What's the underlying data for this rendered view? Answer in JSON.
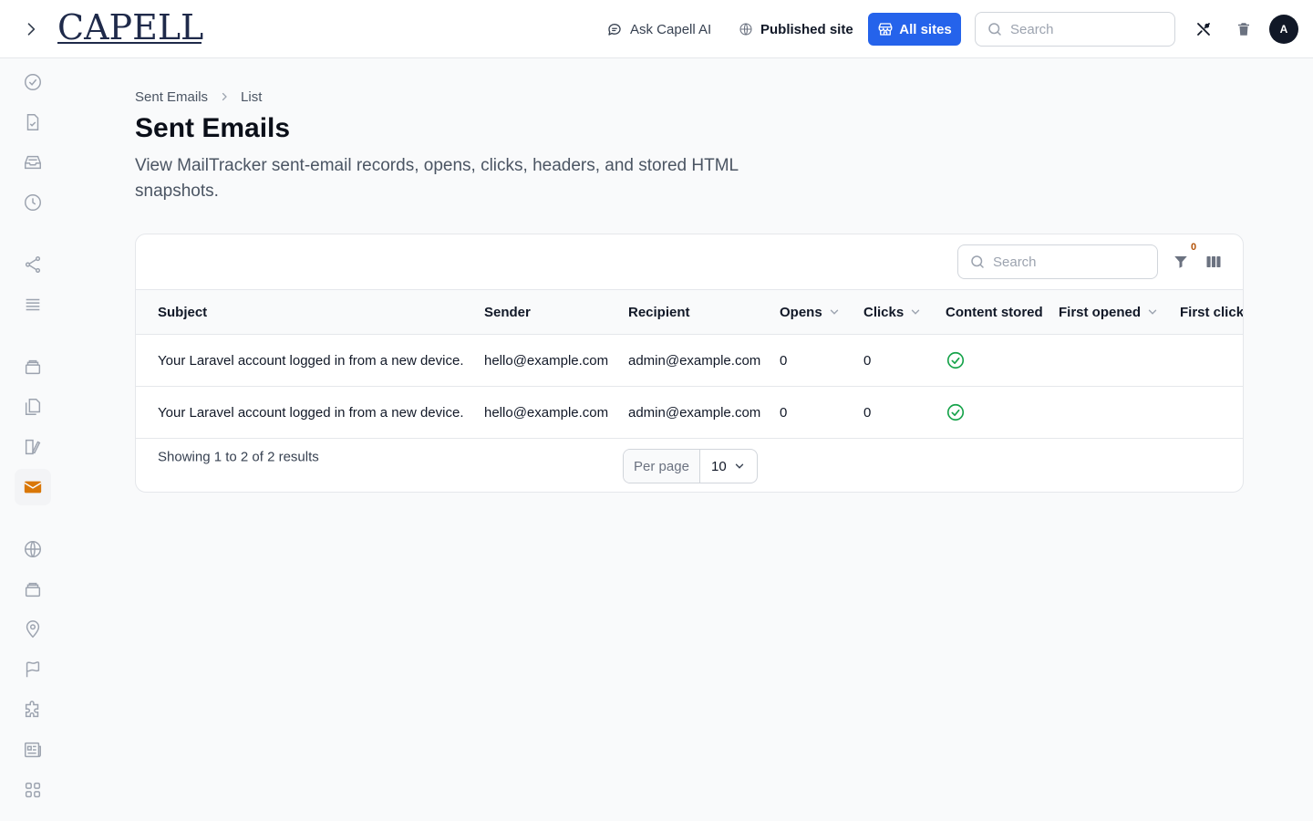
{
  "header": {
    "logo_text": "CAPELL",
    "ask_ai_label": "Ask Capell AI",
    "published_site_label": "Published site",
    "all_sites_label": "All sites",
    "search_placeholder": "Search",
    "avatar_initial": "A"
  },
  "sidebar": {
    "items": [
      {
        "name": "sidebar-item-tasks",
        "icon": "check-circle-icon"
      },
      {
        "name": "sidebar-item-documents",
        "icon": "document-check-icon"
      },
      {
        "name": "sidebar-item-inbox",
        "icon": "inbox-icon"
      },
      {
        "name": "sidebar-item-history",
        "icon": "clock-icon"
      },
      {
        "name": "sidebar-item-share",
        "icon": "share-icon"
      },
      {
        "name": "sidebar-item-list",
        "icon": "list-icon"
      },
      {
        "name": "sidebar-item-stack",
        "icon": "stack-icon"
      },
      {
        "name": "sidebar-item-pages",
        "icon": "copy-icon"
      },
      {
        "name": "sidebar-item-editor",
        "icon": "edit-icon"
      },
      {
        "name": "sidebar-item-emails",
        "icon": "envelope-icon",
        "active": true
      },
      {
        "name": "sidebar-item-globe",
        "icon": "globe-icon"
      },
      {
        "name": "sidebar-item-archive",
        "icon": "stack-icon"
      },
      {
        "name": "sidebar-item-locations",
        "icon": "map-pin-icon"
      },
      {
        "name": "sidebar-item-flags",
        "icon": "flag-icon"
      },
      {
        "name": "sidebar-item-plugins",
        "icon": "puzzle-icon"
      },
      {
        "name": "sidebar-item-news",
        "icon": "newspaper-icon"
      },
      {
        "name": "sidebar-item-apps",
        "icon": "grid-icon"
      }
    ]
  },
  "breadcrumb": {
    "root": "Sent Emails",
    "current": "List"
  },
  "page": {
    "title": "Sent Emails",
    "description": "View MailTracker sent-email records, opens, clicks, headers, and stored HTML snapshots."
  },
  "table": {
    "search_placeholder": "Search",
    "filter_count": "0",
    "columns": {
      "subject": "Subject",
      "sender": "Sender",
      "recipient": "Recipient",
      "opens": "Opens",
      "clicks": "Clicks",
      "content_stored": "Content stored",
      "first_opened": "First opened",
      "first_clicked": "First clicke"
    },
    "rows": [
      {
        "subject": "Your Laravel account logged in from a new device.",
        "sender": "hello@example.com",
        "recipient": "admin@example.com",
        "opens": "0",
        "clicks": "0",
        "content_stored": true
      },
      {
        "subject": "Your Laravel account logged in from a new device.",
        "sender": "hello@example.com",
        "recipient": "admin@example.com",
        "opens": "0",
        "clicks": "0",
        "content_stored": true
      }
    ],
    "footer": {
      "showing": "Showing 1 to 2 of 2 results",
      "per_page_label": "Per page",
      "per_page_value": "10"
    }
  },
  "colors": {
    "primary": "#2563eb",
    "active_icon": "#d97706",
    "success": "#16a34a"
  }
}
